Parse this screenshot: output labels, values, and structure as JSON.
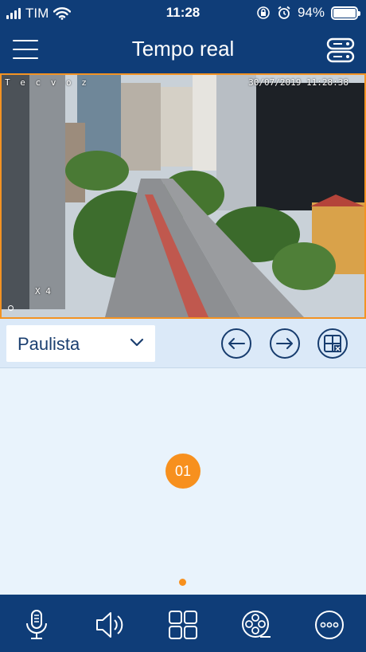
{
  "status_bar": {
    "carrier": "TIM",
    "time": "11:28",
    "battery": "94%"
  },
  "header": {
    "title": "Tempo real"
  },
  "camera_feed": {
    "channel_name": "T e c v o z",
    "timestamp": "30/07/2019 11:28:38",
    "zoom": "X 4"
  },
  "controls": {
    "channel_select_value": "Paulista"
  },
  "channel_grid": {
    "channel_number": "01",
    "page_count": 1,
    "current_page": 1
  },
  "colors": {
    "bar_background": "#0f3d78",
    "accent": "#f7901e",
    "panel_background": "#e9f3fc"
  },
  "icons": {
    "menu": "hamburger-menu-icon",
    "device_list": "server-list-icon",
    "prev": "arrow-left-icon",
    "next": "arrow-right-icon",
    "layout": "grid-delete-icon",
    "talk": "microphone-icon",
    "audio": "speaker-icon",
    "split": "four-split-icon",
    "playback": "film-reel-icon",
    "more": "more-dots-icon"
  }
}
